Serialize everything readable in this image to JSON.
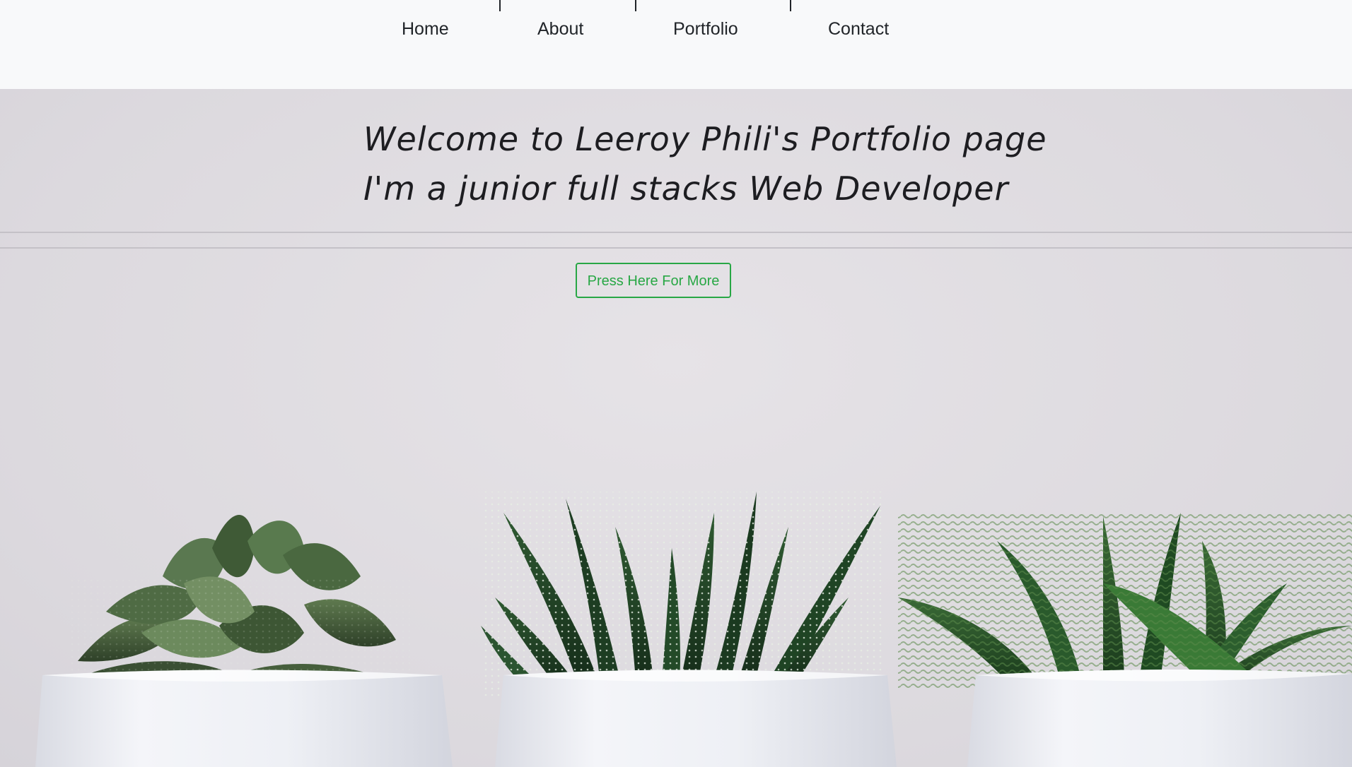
{
  "nav": {
    "items": [
      {
        "label": "Home"
      },
      {
        "label": "About"
      },
      {
        "label": "Portfolio"
      },
      {
        "label": "Contact"
      }
    ]
  },
  "hero": {
    "line1": "Welcome to Leeroy Phili's Portfolio page",
    "line2": "I'm a junior full stacks Web Developer",
    "button_label": "Press Here For More"
  },
  "colors": {
    "nav_bg": "#f8f9fa",
    "accent_green": "#28a745",
    "text_dark": "#212529"
  }
}
